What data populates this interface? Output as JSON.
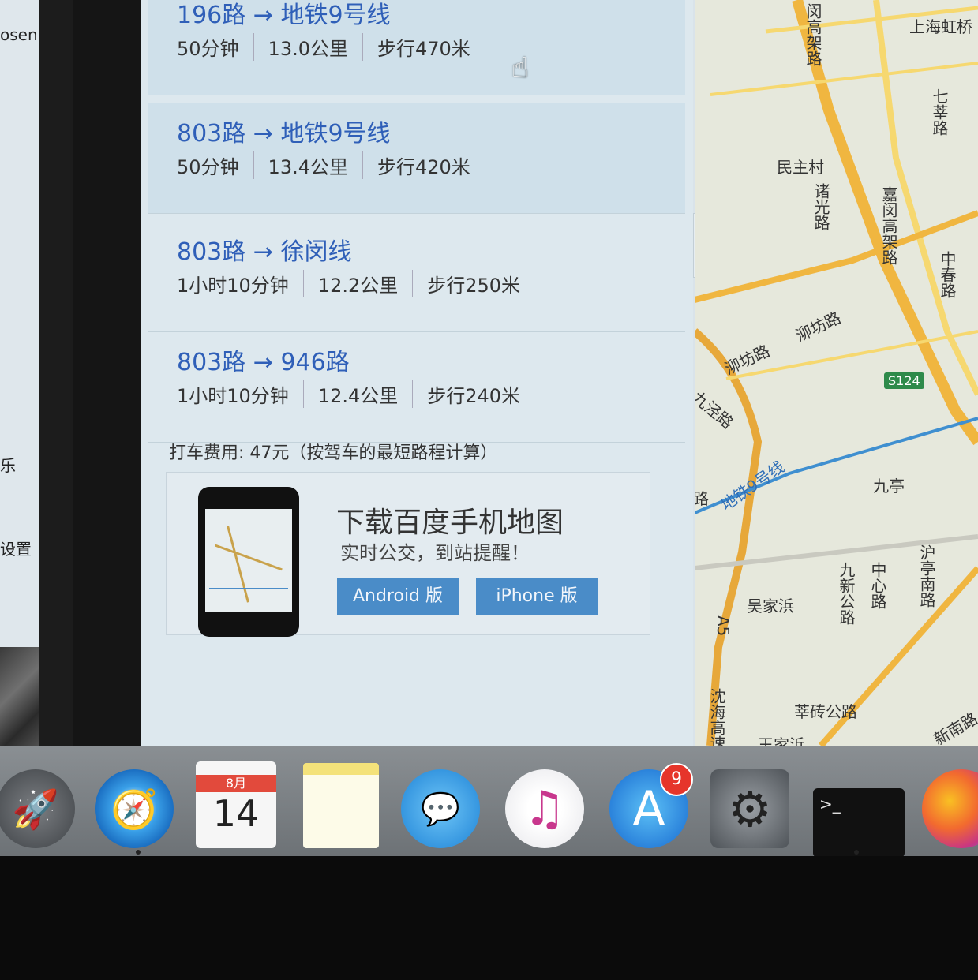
{
  "routes": [
    {
      "title": "196路 → 地铁9号线",
      "duration": "50分钟",
      "distance": "13.0公里",
      "walk": "步行470米"
    },
    {
      "title": "803路 → 地铁9号线",
      "duration": "50分钟",
      "distance": "13.4公里",
      "walk": "步行420米"
    },
    {
      "title": "803路 → 徐闵线",
      "duration": "1小时10分钟",
      "distance": "12.2公里",
      "walk": "步行250米"
    },
    {
      "title": "803路 → 946路",
      "duration": "1小时10分钟",
      "distance": "12.4公里",
      "walk": "步行240米"
    }
  ],
  "taxi": "打车费用: 47元（按驾车的最短路程计算）",
  "promo": {
    "title": "下载百度手机地图",
    "subtitle": "实时公交，到站提醒！",
    "android_label": "Android 版",
    "iphone_label": "iPhone 版"
  },
  "left_window": {
    "text_top": "osen",
    "text_mid": "乐",
    "text_bottom": "设置"
  },
  "map": {
    "labels": {
      "shanghai_hong": "上海虹桥",
      "minzhu_village": "民主村",
      "luofang_road_1": "泖坊路",
      "luofang_road_2": "泖坊路",
      "jiuting": "九亭",
      "wujiabang": "吴家浜",
      "wangjiabang": "王家浜",
      "huazhuan_road": "莘砖公路",
      "xinnan_road": "新南路",
      "minhang_elevated": "闵高架路",
      "qixin_road": "七莘路",
      "zhuguang_road": "诸光路",
      "jiamin_elevated": "嘉闵高架路",
      "zhongchun_road": "中春路",
      "jiujing_road": "九泾路",
      "metro_line9": "地铁9号线",
      "jiuxin_road": "九新公路",
      "zhongxin_road": "中心路",
      "hutingnan_road": "沪亭南路",
      "shenhai_expressway": "沈海高速",
      "a5": "A5",
      "lu_left": "路",
      "s124": "S124"
    }
  },
  "dock": {
    "calendar_month": "8月",
    "calendar_day": "14",
    "appstore_badge": "9",
    "terminal_prompt": ">_"
  },
  "colors": {
    "link": "#2f5fb8",
    "promo_button": "#4a8cc8",
    "badge": "#e6352b"
  }
}
